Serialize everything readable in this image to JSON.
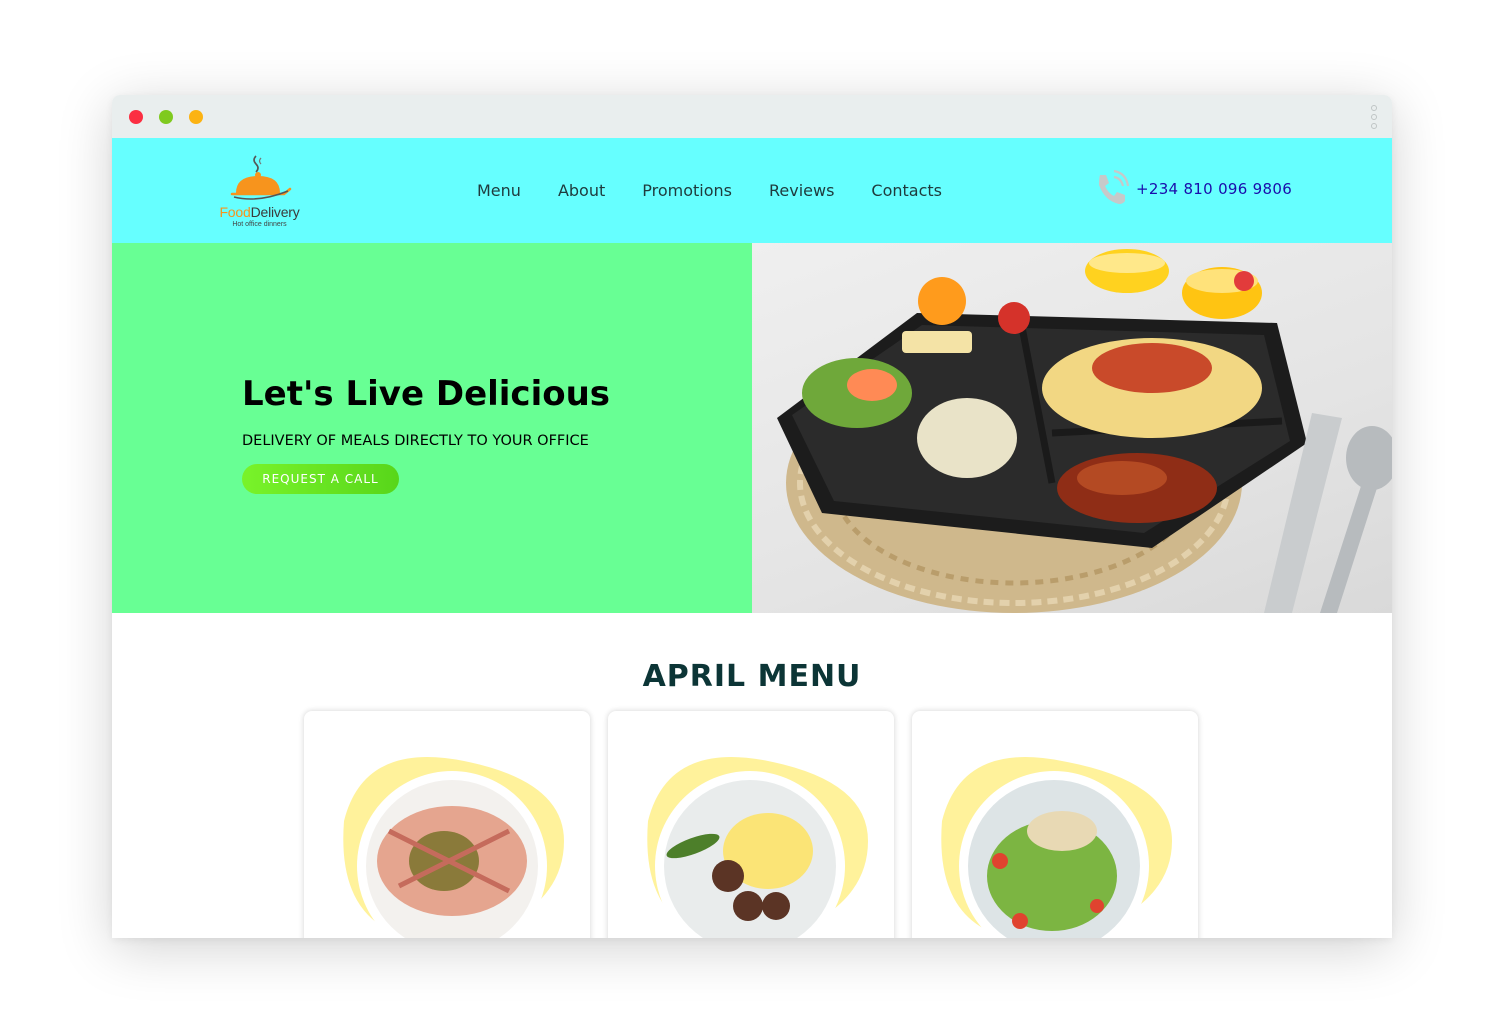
{
  "brand": {
    "name_part1": "Food",
    "name_part2": "Delivery",
    "tagline": "Hot office dinners"
  },
  "nav": {
    "items": [
      "Menu",
      "About",
      "Promotions",
      "Reviews",
      "Contacts"
    ]
  },
  "contact": {
    "phone": "+234 810 096 9806"
  },
  "hero": {
    "title": "Let's Live Delicious",
    "subtitle": "DELIVERY OF MEALS DIRECTLY TO YOUR OFFICE",
    "cta_label": "REQUEST A CALL"
  },
  "menu_section": {
    "title": "APRIL MENU",
    "cards": [
      {
        "dish": "grilled-meat-plate"
      },
      {
        "dish": "meatballs-mashed-potato-plate"
      },
      {
        "dish": "salad-plate"
      }
    ]
  },
  "colors": {
    "header_bg": "#66ffff",
    "hero_bg": "#68ff94",
    "cta_green": "#6ae622",
    "menu_title": "#0c3536",
    "blob_yellow": "#fff29b"
  },
  "icons": {
    "window_controls": [
      "close-dot",
      "minimize-dot",
      "maximize-dot"
    ],
    "menu": "kebab-menu-icon",
    "phone": "phone-icon",
    "logo": "cloche-icon"
  }
}
